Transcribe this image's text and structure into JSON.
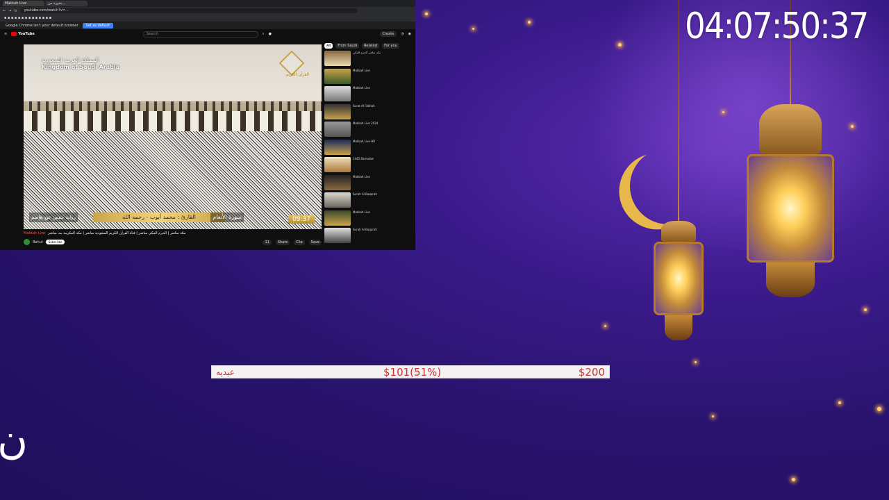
{
  "overlay": {
    "timer": "04:07:50:37",
    "goal": {
      "label": "عيديه",
      "current": "$101(51%)",
      "target": "$200",
      "progress_fraction": 0.51
    },
    "corner_text": "ن"
  },
  "browser": {
    "tabs": [
      "Makkah Live",
      "سورة من..."
    ],
    "url": "youtube.com/watch?v=...",
    "notice_text": "Google Chrome isn't your default browser",
    "notice_button": "Set as default",
    "youtube": {
      "logo": "YouTube",
      "search_placeholder": "Search",
      "create_label": "Create",
      "filter_chips": [
        "All",
        "From Saudi",
        "Related",
        "For you"
      ],
      "video": {
        "title_ar": "المملكة العربية السعودية",
        "title_en": "Kingdom of Saudi Arabia",
        "lower_third": "القارئ : محمد أيوب - رحمه الله",
        "surah": "سورة الأنعام",
        "riwaya": "رواية حفص عن عاصم",
        "time": "09:37",
        "temperature": "31°C",
        "channel_logo_text": "القرآن الكريم"
      },
      "video_title": "مكة مباشر | الحرم المكي مباشر | قناة القرآن الكريم السعودية مباشر | مكة المكرمة بث مباشر",
      "live_tag": "Makkah Live",
      "channel_name": "Bahut",
      "subscribe": "Subscribe",
      "actions": [
        "11",
        "Share",
        "Clip",
        "Save"
      ],
      "recommendations": [
        "مكة مباشر الحرم المكي",
        "Makkah Live",
        "Makkah Live",
        "Surat Al Fatihah",
        "Makkah Live 2024",
        "Makkah Live HD",
        "1445 Ramadan",
        "Makkah Live",
        "Surah Al Baqarah",
        "Makkah Live",
        "Surah Al Baqarah"
      ]
    }
  }
}
